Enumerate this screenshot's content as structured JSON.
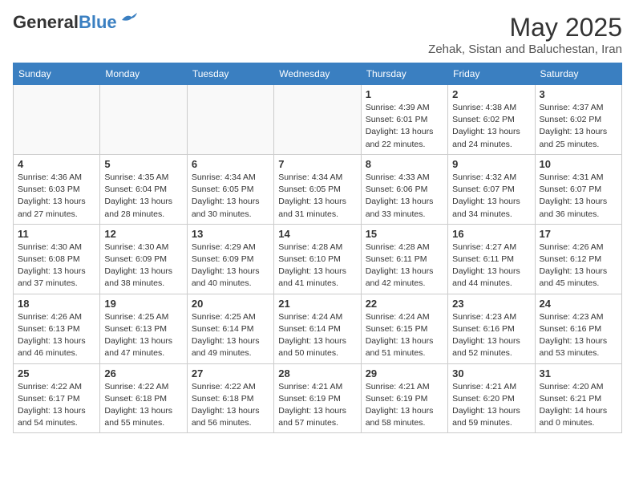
{
  "header": {
    "logo_general": "General",
    "logo_blue": "Blue",
    "month": "May 2025",
    "location": "Zehak, Sistan and Baluchestan, Iran"
  },
  "days_of_week": [
    "Sunday",
    "Monday",
    "Tuesday",
    "Wednesday",
    "Thursday",
    "Friday",
    "Saturday"
  ],
  "weeks": [
    [
      {
        "day": "",
        "info": ""
      },
      {
        "day": "",
        "info": ""
      },
      {
        "day": "",
        "info": ""
      },
      {
        "day": "",
        "info": ""
      },
      {
        "day": "1",
        "info": "Sunrise: 4:39 AM\nSunset: 6:01 PM\nDaylight: 13 hours\nand 22 minutes."
      },
      {
        "day": "2",
        "info": "Sunrise: 4:38 AM\nSunset: 6:02 PM\nDaylight: 13 hours\nand 24 minutes."
      },
      {
        "day": "3",
        "info": "Sunrise: 4:37 AM\nSunset: 6:02 PM\nDaylight: 13 hours\nand 25 minutes."
      }
    ],
    [
      {
        "day": "4",
        "info": "Sunrise: 4:36 AM\nSunset: 6:03 PM\nDaylight: 13 hours\nand 27 minutes."
      },
      {
        "day": "5",
        "info": "Sunrise: 4:35 AM\nSunset: 6:04 PM\nDaylight: 13 hours\nand 28 minutes."
      },
      {
        "day": "6",
        "info": "Sunrise: 4:34 AM\nSunset: 6:05 PM\nDaylight: 13 hours\nand 30 minutes."
      },
      {
        "day": "7",
        "info": "Sunrise: 4:34 AM\nSunset: 6:05 PM\nDaylight: 13 hours\nand 31 minutes."
      },
      {
        "day": "8",
        "info": "Sunrise: 4:33 AM\nSunset: 6:06 PM\nDaylight: 13 hours\nand 33 minutes."
      },
      {
        "day": "9",
        "info": "Sunrise: 4:32 AM\nSunset: 6:07 PM\nDaylight: 13 hours\nand 34 minutes."
      },
      {
        "day": "10",
        "info": "Sunrise: 4:31 AM\nSunset: 6:07 PM\nDaylight: 13 hours\nand 36 minutes."
      }
    ],
    [
      {
        "day": "11",
        "info": "Sunrise: 4:30 AM\nSunset: 6:08 PM\nDaylight: 13 hours\nand 37 minutes."
      },
      {
        "day": "12",
        "info": "Sunrise: 4:30 AM\nSunset: 6:09 PM\nDaylight: 13 hours\nand 38 minutes."
      },
      {
        "day": "13",
        "info": "Sunrise: 4:29 AM\nSunset: 6:09 PM\nDaylight: 13 hours\nand 40 minutes."
      },
      {
        "day": "14",
        "info": "Sunrise: 4:28 AM\nSunset: 6:10 PM\nDaylight: 13 hours\nand 41 minutes."
      },
      {
        "day": "15",
        "info": "Sunrise: 4:28 AM\nSunset: 6:11 PM\nDaylight: 13 hours\nand 42 minutes."
      },
      {
        "day": "16",
        "info": "Sunrise: 4:27 AM\nSunset: 6:11 PM\nDaylight: 13 hours\nand 44 minutes."
      },
      {
        "day": "17",
        "info": "Sunrise: 4:26 AM\nSunset: 6:12 PM\nDaylight: 13 hours\nand 45 minutes."
      }
    ],
    [
      {
        "day": "18",
        "info": "Sunrise: 4:26 AM\nSunset: 6:13 PM\nDaylight: 13 hours\nand 46 minutes."
      },
      {
        "day": "19",
        "info": "Sunrise: 4:25 AM\nSunset: 6:13 PM\nDaylight: 13 hours\nand 47 minutes."
      },
      {
        "day": "20",
        "info": "Sunrise: 4:25 AM\nSunset: 6:14 PM\nDaylight: 13 hours\nand 49 minutes."
      },
      {
        "day": "21",
        "info": "Sunrise: 4:24 AM\nSunset: 6:14 PM\nDaylight: 13 hours\nand 50 minutes."
      },
      {
        "day": "22",
        "info": "Sunrise: 4:24 AM\nSunset: 6:15 PM\nDaylight: 13 hours\nand 51 minutes."
      },
      {
        "day": "23",
        "info": "Sunrise: 4:23 AM\nSunset: 6:16 PM\nDaylight: 13 hours\nand 52 minutes."
      },
      {
        "day": "24",
        "info": "Sunrise: 4:23 AM\nSunset: 6:16 PM\nDaylight: 13 hours\nand 53 minutes."
      }
    ],
    [
      {
        "day": "25",
        "info": "Sunrise: 4:22 AM\nSunset: 6:17 PM\nDaylight: 13 hours\nand 54 minutes."
      },
      {
        "day": "26",
        "info": "Sunrise: 4:22 AM\nSunset: 6:18 PM\nDaylight: 13 hours\nand 55 minutes."
      },
      {
        "day": "27",
        "info": "Sunrise: 4:22 AM\nSunset: 6:18 PM\nDaylight: 13 hours\nand 56 minutes."
      },
      {
        "day": "28",
        "info": "Sunrise: 4:21 AM\nSunset: 6:19 PM\nDaylight: 13 hours\nand 57 minutes."
      },
      {
        "day": "29",
        "info": "Sunrise: 4:21 AM\nSunset: 6:19 PM\nDaylight: 13 hours\nand 58 minutes."
      },
      {
        "day": "30",
        "info": "Sunrise: 4:21 AM\nSunset: 6:20 PM\nDaylight: 13 hours\nand 59 minutes."
      },
      {
        "day": "31",
        "info": "Sunrise: 4:20 AM\nSunset: 6:21 PM\nDaylight: 14 hours\nand 0 minutes."
      }
    ]
  ]
}
